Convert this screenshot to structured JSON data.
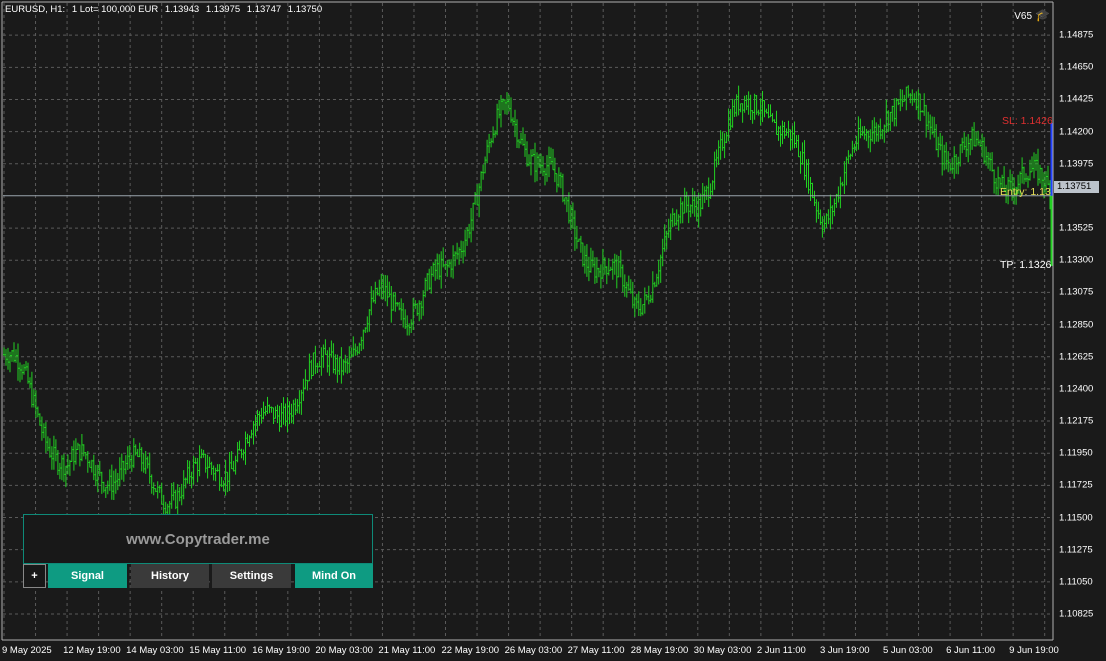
{
  "header": {
    "symbol": "EURUSD, H1:",
    "lot": "1 Lot= 100,000 EUR",
    "open": "1.13943",
    "high": "1.13975",
    "low": "1.13747",
    "close": "1.13750"
  },
  "version": "V65",
  "colors": {
    "background": "#1a1a1a",
    "grid": "#5a5a5a",
    "bars": "#22d022",
    "accent": "#0e9b82",
    "entry": "#e6e055",
    "stop_loss": "#e03030"
  },
  "price_ticks": [
    "1.14875",
    "1.14650",
    "1.14425",
    "1.14200",
    "1.13975",
    "1.13525",
    "1.13300",
    "1.13075",
    "1.12850",
    "1.12625",
    "1.12400",
    "1.12175",
    "1.11950",
    "1.11725",
    "1.11500",
    "1.11275",
    "1.11050",
    "1.10825"
  ],
  "current_price": "1.13751",
  "time_ticks": [
    "9 May 2025",
    "12 May 19:00",
    "14 May 03:00",
    "15 May 11:00",
    "16 May 19:00",
    "20 May 03:00",
    "21 May 11:00",
    "22 May 19:00",
    "26 May 03:00",
    "27 May 11:00",
    "28 May 19:00",
    "30 May 03:00",
    "2 Jun 11:00",
    "3 Jun 19:00",
    "5 Jun 03:00",
    "6 Jun 11:00",
    "9 Jun 19:00"
  ],
  "trade_labels": {
    "entry": "Entry: 1.13",
    "stop_loss": "SL: 1.1426",
    "take_profit": "TP: 1.1326"
  },
  "panel": {
    "url": "www.Copytrader.me",
    "buttons": {
      "plus": "+",
      "signal": "Signal",
      "history": "History",
      "settings": "Settings",
      "mind_on": "Mind On"
    }
  },
  "chart_data": {
    "type": "line",
    "symbol": "EURUSD",
    "timeframe": "H1",
    "ylim": [
      1.1065,
      1.151
    ],
    "grid": true,
    "x": [
      "9 May 2025",
      "12 May 19:00",
      "14 May 03:00",
      "15 May 11:00",
      "16 May 19:00",
      "20 May 03:00",
      "21 May 11:00",
      "22 May 19:00",
      "26 May 03:00",
      "27 May 11:00",
      "28 May 19:00",
      "30 May 03:00",
      "2 Jun 11:00",
      "3 Jun 19:00",
      "5 Jun 03:00",
      "6 Jun 11:00",
      "9 Jun 19:00"
    ],
    "series": [
      {
        "values": [
          1.1264,
          1.1164,
          1.1192,
          1.1188,
          1.1192,
          1.1242,
          1.1318,
          1.1315,
          1.1418,
          1.1366,
          1.1315,
          1.1361,
          1.1442,
          1.1385,
          1.1442,
          1.139,
          1.1398
        ]
      }
    ],
    "current_price": 1.13751,
    "entry": 1.1375,
    "stop_loss": 1.1426,
    "take_profit": 1.1326
  }
}
